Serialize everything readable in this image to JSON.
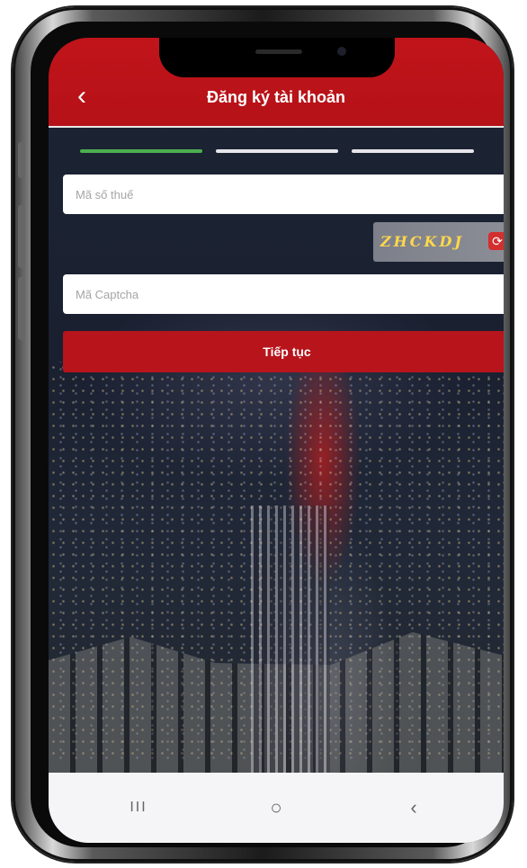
{
  "header": {
    "back_glyph": "‹",
    "title": "Đăng ký tài khoản"
  },
  "steps": {
    "count": 3,
    "active": 1,
    "active_color": "#4caf50"
  },
  "form": {
    "tax_code_placeholder": "Mã số thuế",
    "captcha_image_text": "ZHCKDJ",
    "captcha_placeholder": "Mã Captcha",
    "continue_label": "Tiếp tục"
  },
  "navbar": {
    "recents_glyph": "III",
    "home_glyph": "○",
    "back_glyph": "‹"
  },
  "colors": {
    "brand_red": "#b8141b",
    "header_red": "#c0141a"
  }
}
